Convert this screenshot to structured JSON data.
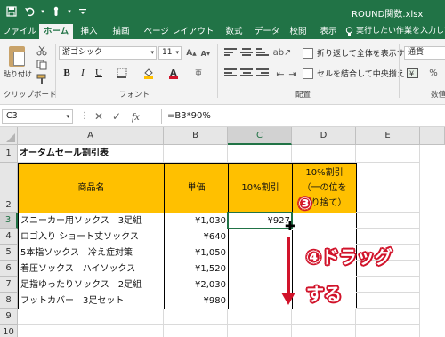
{
  "window": {
    "title": "ROUND関数.xlsx"
  },
  "qat": {
    "save_icon": "save-icon",
    "undo_icon": "undo-icon",
    "touch_icon": "touch-mode-icon"
  },
  "tabs": [
    {
      "label": "ファイル",
      "active": false
    },
    {
      "label": "ホーム",
      "active": true
    },
    {
      "label": "挿入",
      "active": false
    },
    {
      "label": "描画",
      "active": false
    },
    {
      "label": "ページ レイアウト",
      "active": false
    },
    {
      "label": "数式",
      "active": false
    },
    {
      "label": "データ",
      "active": false
    },
    {
      "label": "校閲",
      "active": false
    },
    {
      "label": "表示",
      "active": false
    }
  ],
  "tell_me": "実行したい作業を入力してく",
  "ribbon": {
    "paste_label": "貼り付け",
    "clipboard_label": "クリップボード",
    "font_name": "游ゴシック",
    "font_size": "11",
    "font_label": "フォント",
    "wrap_text": "折り返して全体を表示する",
    "merge_center": "セルを結合して中央揃え",
    "alignment_label": "配置",
    "number_format": "通貨",
    "number_label": "数値"
  },
  "formula_bar": {
    "name_box": "C3",
    "formula": "=B3*90%"
  },
  "columns": [
    "A",
    "B",
    "C",
    "D",
    "E"
  ],
  "rows": [
    "1",
    "2",
    "3",
    "4",
    "5",
    "6",
    "7",
    "8",
    "9",
    "10"
  ],
  "sheet": {
    "title": "オータムセール割引表",
    "header": {
      "product": "商品名",
      "price": "単価",
      "discount": "10%割引",
      "discount_round": "10%割引（一の位を切り捨て）"
    },
    "items": [
      {
        "name": "スニーカー用ソックス　3足組",
        "price": "¥1,030",
        "disc": "¥927"
      },
      {
        "name": "ロゴ入り ショート丈ソックス",
        "price": "¥640",
        "disc": ""
      },
      {
        "name": "5本指ソックス　冷え症対策",
        "price": "¥1,050",
        "disc": ""
      },
      {
        "name": "着圧ソックス　ハイソックス",
        "price": "¥1,520",
        "disc": ""
      },
      {
        "name": "足指ゆったりソックス　2足組",
        "price": "¥2,030",
        "disc": ""
      },
      {
        "name": "フットカバー　3足セット",
        "price": "¥980",
        "disc": ""
      }
    ]
  },
  "annotations": {
    "step3": "③",
    "step4_line1": "④ドラッグ",
    "step4_line2": "する",
    "accent": "#d1132a"
  }
}
